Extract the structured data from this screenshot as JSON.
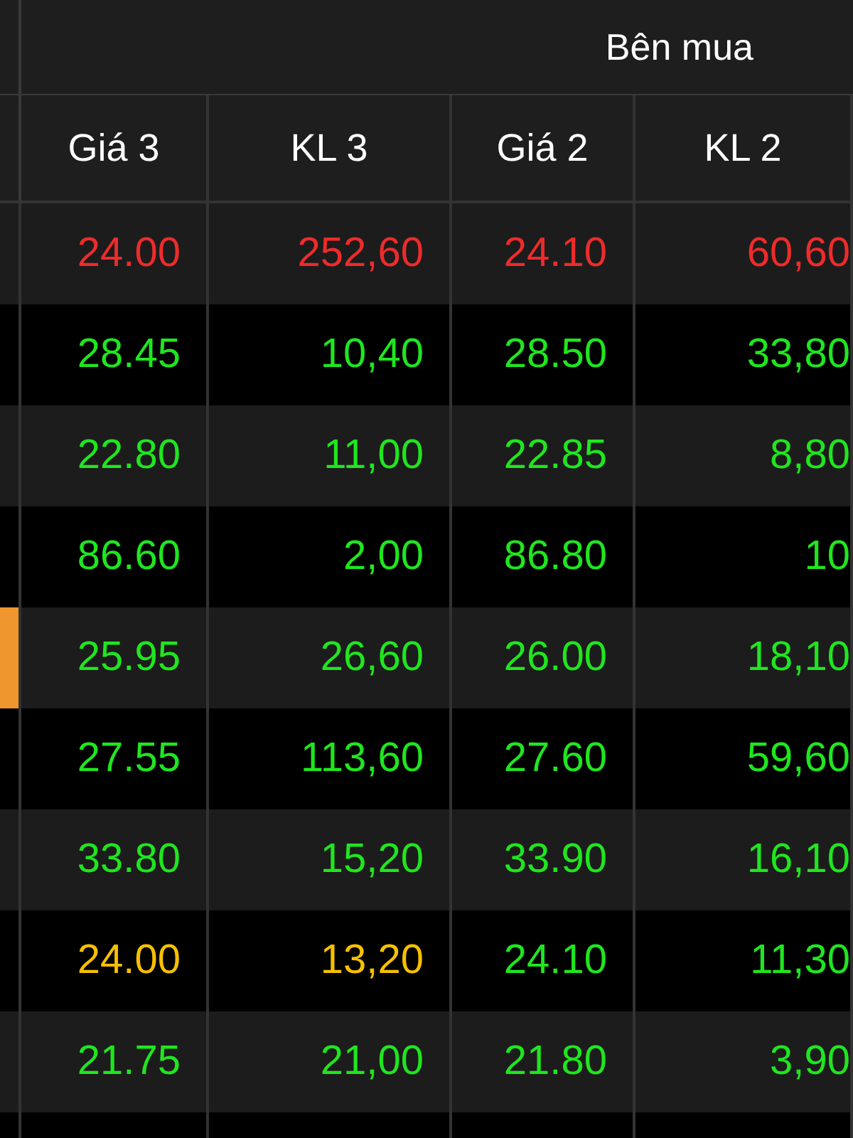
{
  "group_header": "Bên mua",
  "columns": [
    "Giá 3",
    "KL 3",
    "Giá 2",
    "KL 2"
  ],
  "rows": [
    {
      "highlighted": false,
      "cells": [
        {
          "text": "24.00",
          "color": "#ee2b2b"
        },
        {
          "text": "252,60",
          "color": "#ee2b2b"
        },
        {
          "text": "24.10",
          "color": "#ee2b2b"
        },
        {
          "text": "60,60",
          "color": "#ee2b2b"
        }
      ]
    },
    {
      "highlighted": false,
      "cells": [
        {
          "text": "28.45",
          "color": "#1fe61f"
        },
        {
          "text": "10,40",
          "color": "#1fe61f"
        },
        {
          "text": "28.50",
          "color": "#1fe61f"
        },
        {
          "text": "33,80",
          "color": "#1fe61f"
        }
      ]
    },
    {
      "highlighted": false,
      "cells": [
        {
          "text": "22.80",
          "color": "#1fe61f"
        },
        {
          "text": "11,00",
          "color": "#1fe61f"
        },
        {
          "text": "22.85",
          "color": "#1fe61f"
        },
        {
          "text": "8,80",
          "color": "#1fe61f"
        }
      ]
    },
    {
      "highlighted": false,
      "cells": [
        {
          "text": "86.60",
          "color": "#1fe61f"
        },
        {
          "text": "2,00",
          "color": "#1fe61f"
        },
        {
          "text": "86.80",
          "color": "#1fe61f"
        },
        {
          "text": "10",
          "color": "#1fe61f"
        }
      ]
    },
    {
      "highlighted": true,
      "cells": [
        {
          "text": "25.95",
          "color": "#1fe61f"
        },
        {
          "text": "26,60",
          "color": "#1fe61f"
        },
        {
          "text": "26.00",
          "color": "#1fe61f"
        },
        {
          "text": "18,10",
          "color": "#1fe61f"
        }
      ]
    },
    {
      "highlighted": false,
      "cells": [
        {
          "text": "27.55",
          "color": "#1fe61f"
        },
        {
          "text": "113,60",
          "color": "#1fe61f"
        },
        {
          "text": "27.60",
          "color": "#1fe61f"
        },
        {
          "text": "59,60",
          "color": "#1fe61f"
        }
      ]
    },
    {
      "highlighted": false,
      "cells": [
        {
          "text": "33.80",
          "color": "#1fe61f"
        },
        {
          "text": "15,20",
          "color": "#1fe61f"
        },
        {
          "text": "33.90",
          "color": "#1fe61f"
        },
        {
          "text": "16,10",
          "color": "#1fe61f"
        }
      ]
    },
    {
      "highlighted": false,
      "cells": [
        {
          "text": "24.00",
          "color": "#f5c000"
        },
        {
          "text": "13,20",
          "color": "#f5c000"
        },
        {
          "text": "24.10",
          "color": "#1fe61f"
        },
        {
          "text": "11,30",
          "color": "#1fe61f"
        }
      ]
    },
    {
      "highlighted": false,
      "cells": [
        {
          "text": "21.75",
          "color": "#1fe61f"
        },
        {
          "text": "21,00",
          "color": "#1fe61f"
        },
        {
          "text": "21.80",
          "color": "#1fe61f"
        },
        {
          "text": "3,90",
          "color": "#1fe61f"
        }
      ]
    }
  ]
}
